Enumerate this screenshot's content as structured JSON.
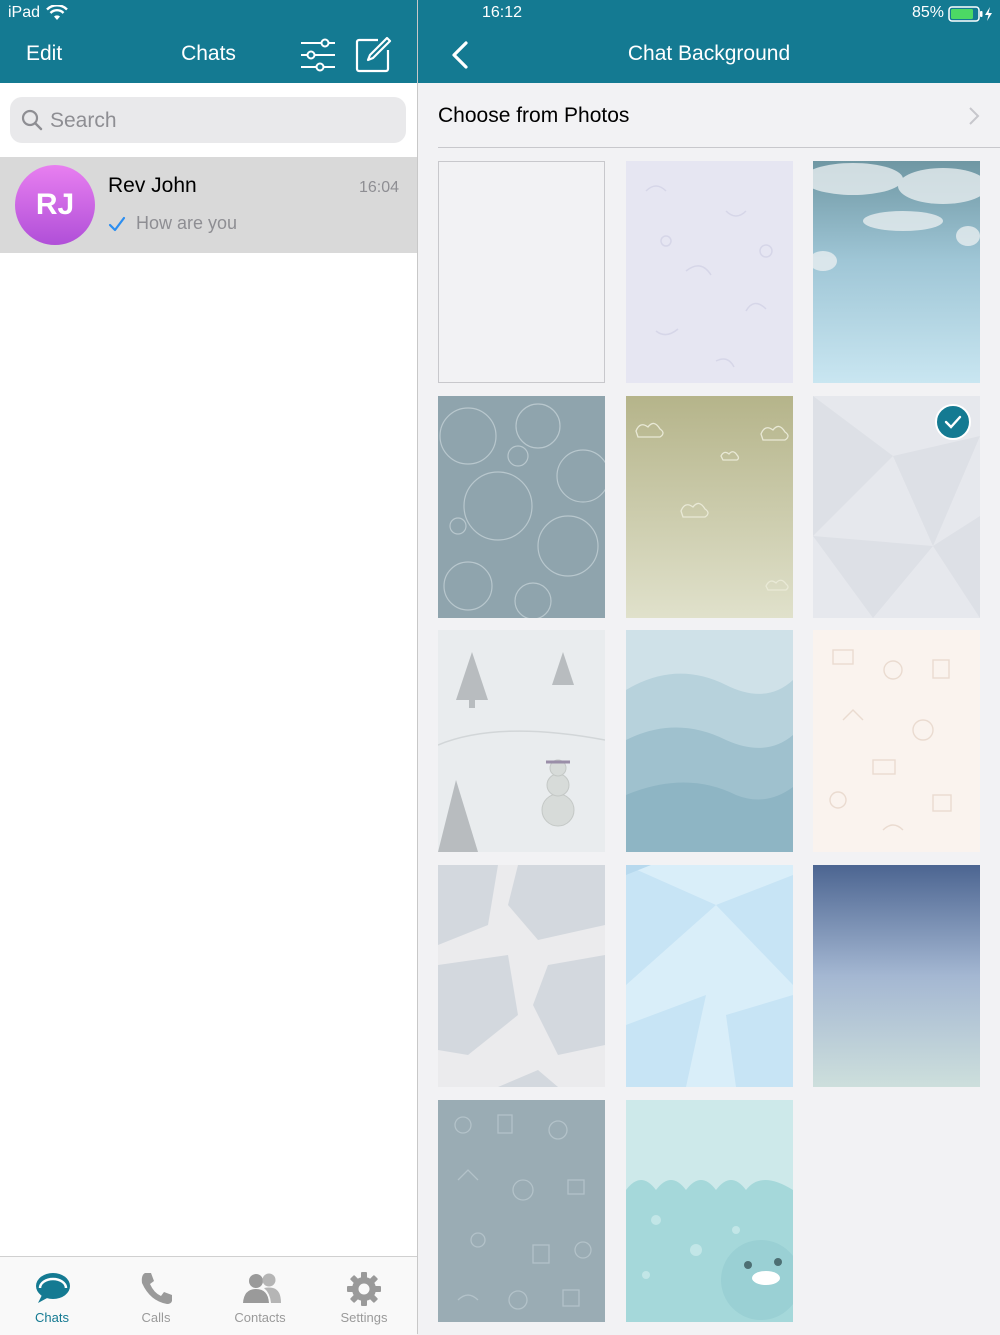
{
  "status_bar": {
    "device": "iPad",
    "time": "16:12",
    "battery": "85%"
  },
  "chats_list": {
    "edit_label": "Edit",
    "title": "Chats",
    "search_placeholder": "Search",
    "conversations": [
      {
        "initials": "RJ",
        "name": "Rev John",
        "time": "16:04",
        "preview": "How are you"
      }
    ]
  },
  "tab_bar": {
    "tabs": [
      {
        "label": "Chats",
        "icon": "chat-bubbles-icon",
        "active": true
      },
      {
        "label": "Calls",
        "icon": "phone-icon",
        "active": false
      },
      {
        "label": "Contacts",
        "icon": "contacts-icon",
        "active": false
      },
      {
        "label": "Settings",
        "icon": "gear-icon",
        "active": false
      }
    ]
  },
  "chat_background": {
    "title": "Chat Background",
    "choose_from_photos": "Choose from Photos",
    "wallpapers": [
      {
        "name": "plain-white",
        "selected": false
      },
      {
        "name": "lavender-doodles",
        "selected": false
      },
      {
        "name": "cloudy-sky",
        "selected": false
      },
      {
        "name": "grey-bubbles",
        "selected": false
      },
      {
        "name": "olive-clouds",
        "selected": false
      },
      {
        "name": "light-geometric",
        "selected": true
      },
      {
        "name": "winter-snowman",
        "selected": false
      },
      {
        "name": "blue-waves",
        "selected": false
      },
      {
        "name": "peach-doodles",
        "selected": false
      },
      {
        "name": "grey-stones",
        "selected": false
      },
      {
        "name": "sky-polygons",
        "selected": false
      },
      {
        "name": "blue-gradient",
        "selected": false
      },
      {
        "name": "grey-doodles",
        "selected": false
      },
      {
        "name": "teal-monster",
        "selected": false
      }
    ]
  },
  "colors": {
    "brand": "#147a92",
    "selected_row": "#d9d9d9",
    "avatar_gradient": [
      "#e87ff0",
      "#b04fd8"
    ],
    "read_check": "#2c8ef0"
  }
}
